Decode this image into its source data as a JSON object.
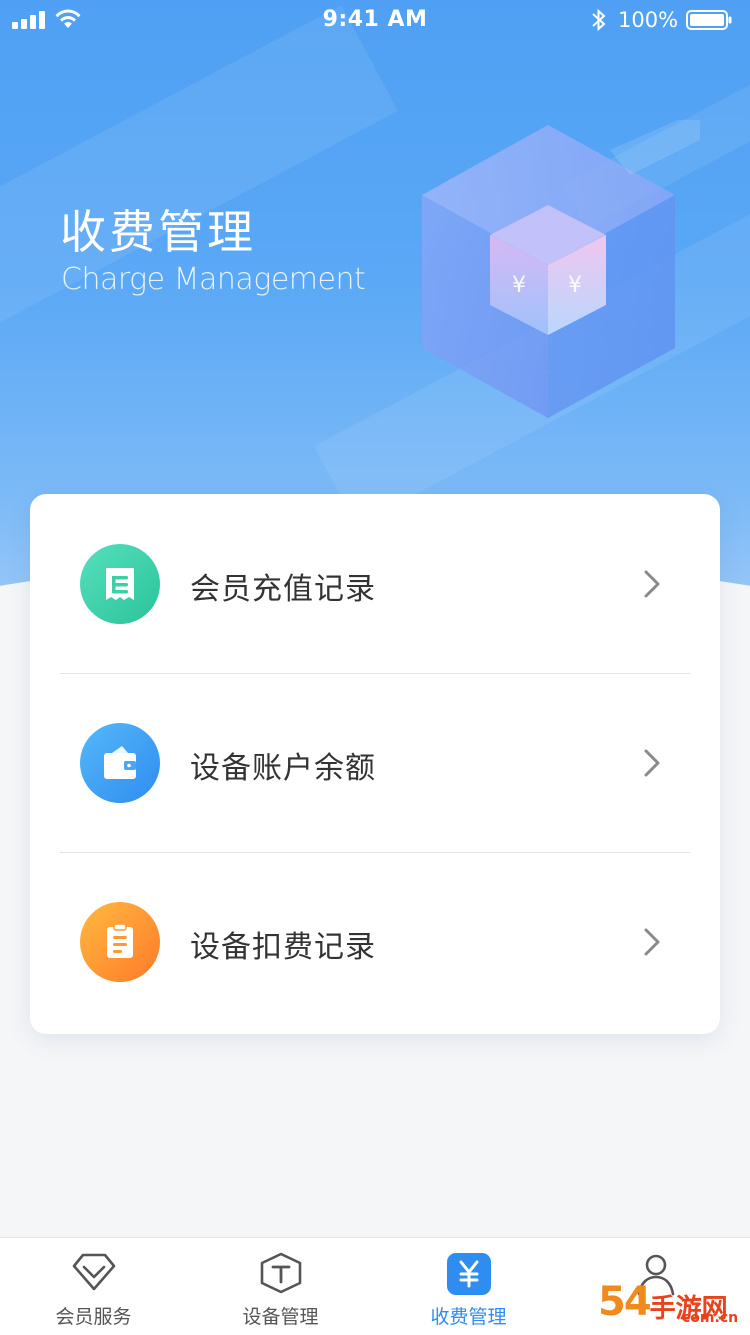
{
  "status_bar": {
    "time": "9:41 AM",
    "battery": "100%"
  },
  "header": {
    "title": "收费管理",
    "subtitle": "Charge Management"
  },
  "menu": {
    "items": [
      {
        "label": "会员充值记录",
        "icon": "receipt-icon",
        "color_from": "#4fdcb4",
        "color_to": "#2cc39b"
      },
      {
        "label": "设备账户余额",
        "icon": "wallet-icon",
        "color_from": "#4fb2f7",
        "color_to": "#2f8cf0"
      },
      {
        "label": "设备扣费记录",
        "icon": "clipboard-icon",
        "color_from": "#ffb13d",
        "color_to": "#ff7e2a"
      }
    ]
  },
  "tabs": [
    {
      "label": "会员服务",
      "icon": "diamond-icon",
      "active": false
    },
    {
      "label": "设备管理",
      "icon": "device-box-icon",
      "active": false
    },
    {
      "label": "收费管理",
      "icon": "yen-icon",
      "active": true
    },
    {
      "label": "",
      "icon": "user-icon",
      "active": false
    }
  ],
  "watermark": {
    "text": "54手游网",
    "sub": "com.cn"
  },
  "colors": {
    "accent": "#2f8cf0",
    "hero": "#4fa0f4"
  }
}
